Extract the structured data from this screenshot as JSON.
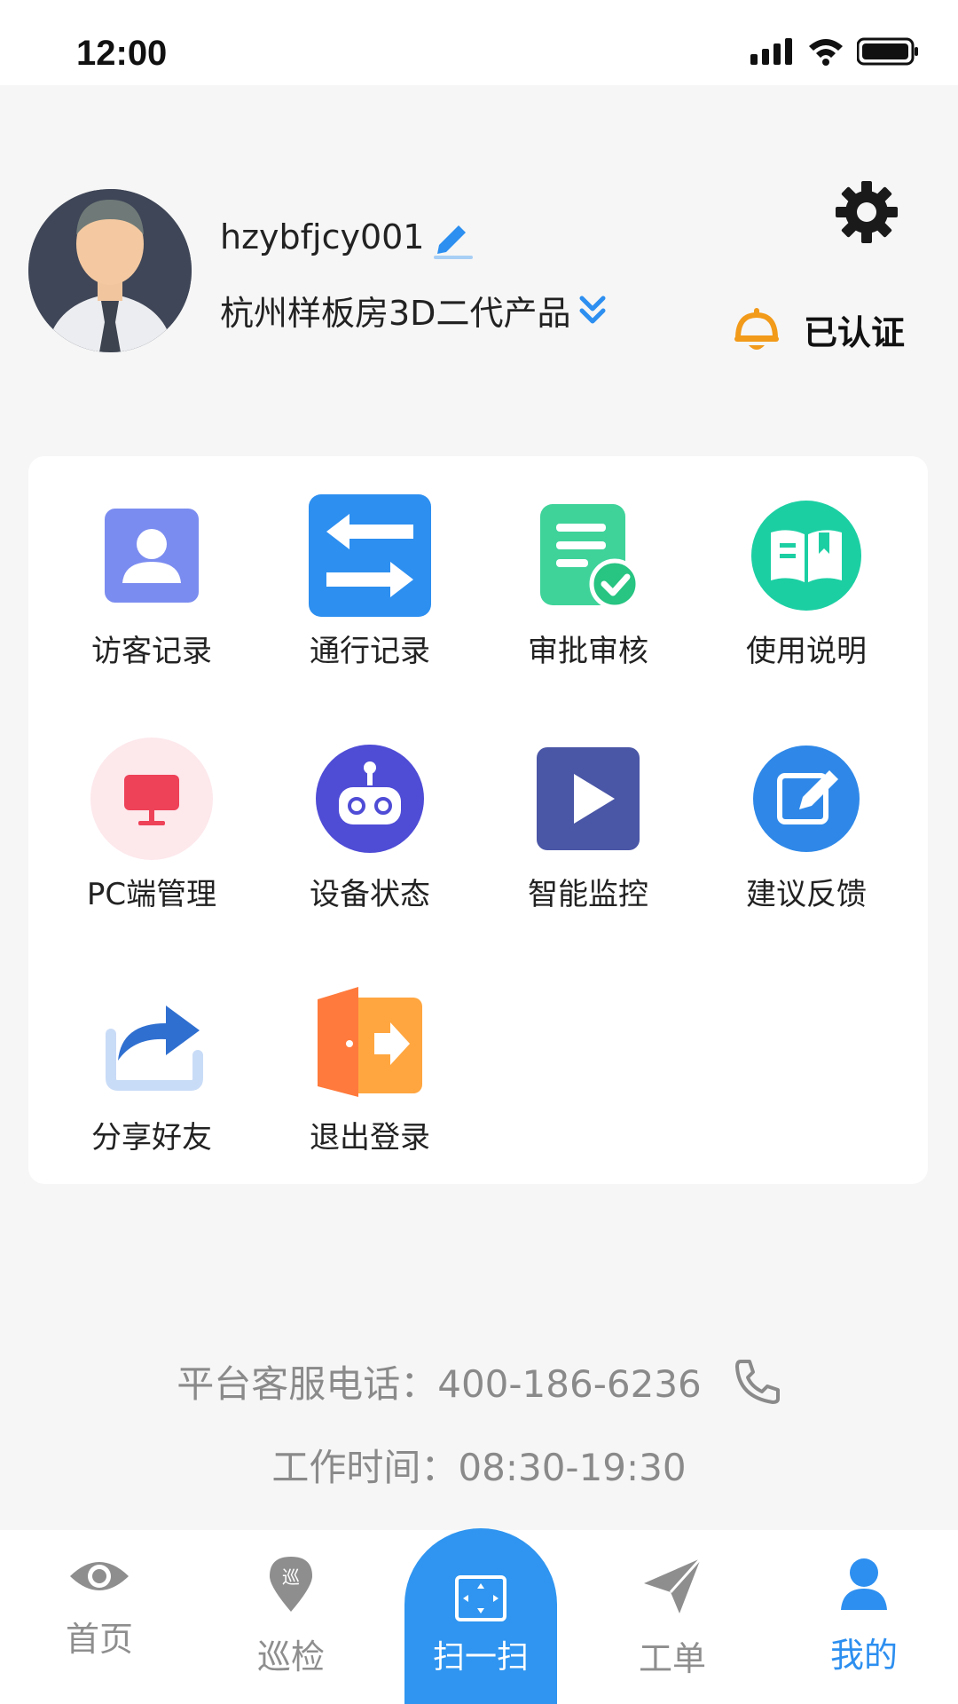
{
  "status_bar": {
    "time": "12:00"
  },
  "profile": {
    "username": "hzybfjcy001",
    "company": "杭州样板房3D二代产品",
    "verified_label": "已认证"
  },
  "menu": {
    "items": [
      {
        "label": "访客记录",
        "icon": "visitor-icon"
      },
      {
        "label": "通行记录",
        "icon": "transfer-arrows-icon"
      },
      {
        "label": "审批审核",
        "icon": "approval-document-icon"
      },
      {
        "label": "使用说明",
        "icon": "manual-book-icon"
      },
      {
        "label": "PC端管理",
        "icon": "monitor-icon"
      },
      {
        "label": "设备状态",
        "icon": "robot-icon"
      },
      {
        "label": "智能监控",
        "icon": "play-icon"
      },
      {
        "label": "建议反馈",
        "icon": "edit-icon"
      },
      {
        "label": "分享好友",
        "icon": "share-icon"
      },
      {
        "label": "退出登录",
        "icon": "logout-door-icon"
      }
    ]
  },
  "contact": {
    "phone_text": "平台客服电话：400-186-6236",
    "hours_text": "工作时间：08:30-19:30"
  },
  "tabbar": {
    "home": "首页",
    "patrol": "巡检",
    "scan": "扫一扫",
    "workorder": "工单",
    "mine": "我的",
    "patrol_icon_char": "巡"
  },
  "colors": {
    "accent": "#2d8ff0",
    "inactive": "#8e8e8e",
    "verified_bell": "#f29a1a"
  }
}
